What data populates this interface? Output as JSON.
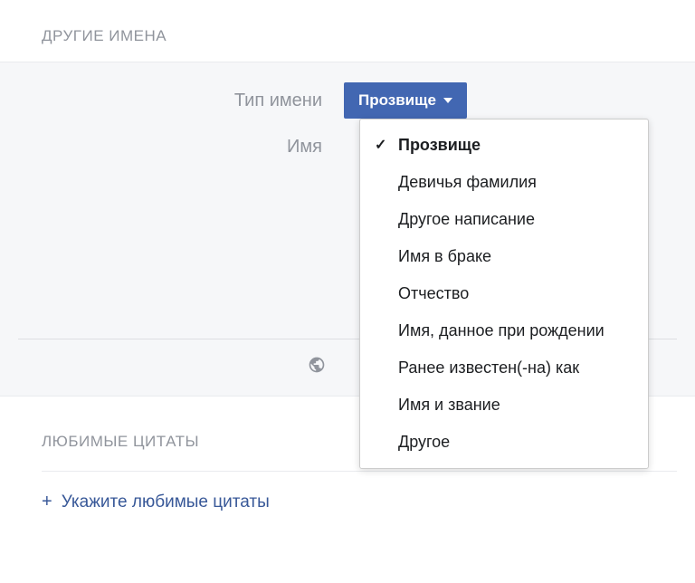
{
  "sections": {
    "otherNames": {
      "header": "ДРУГИЕ ИМЕНА",
      "typeLabel": "Тип имени",
      "nameLabel": "Имя",
      "dropdownSelected": "Прозвище",
      "dropdownOptions": [
        "Прозвище",
        "Девичья фамилия",
        "Другое написание",
        "Имя в браке",
        "Отчество",
        "Имя, данное при рождении",
        "Ранее известен(-на) как",
        "Имя и звание",
        "Другое"
      ]
    },
    "quotes": {
      "header": "ЛЮБИМЫЕ ЦИТАТЫ",
      "addLink": "Укажите любимые цитаты"
    }
  }
}
